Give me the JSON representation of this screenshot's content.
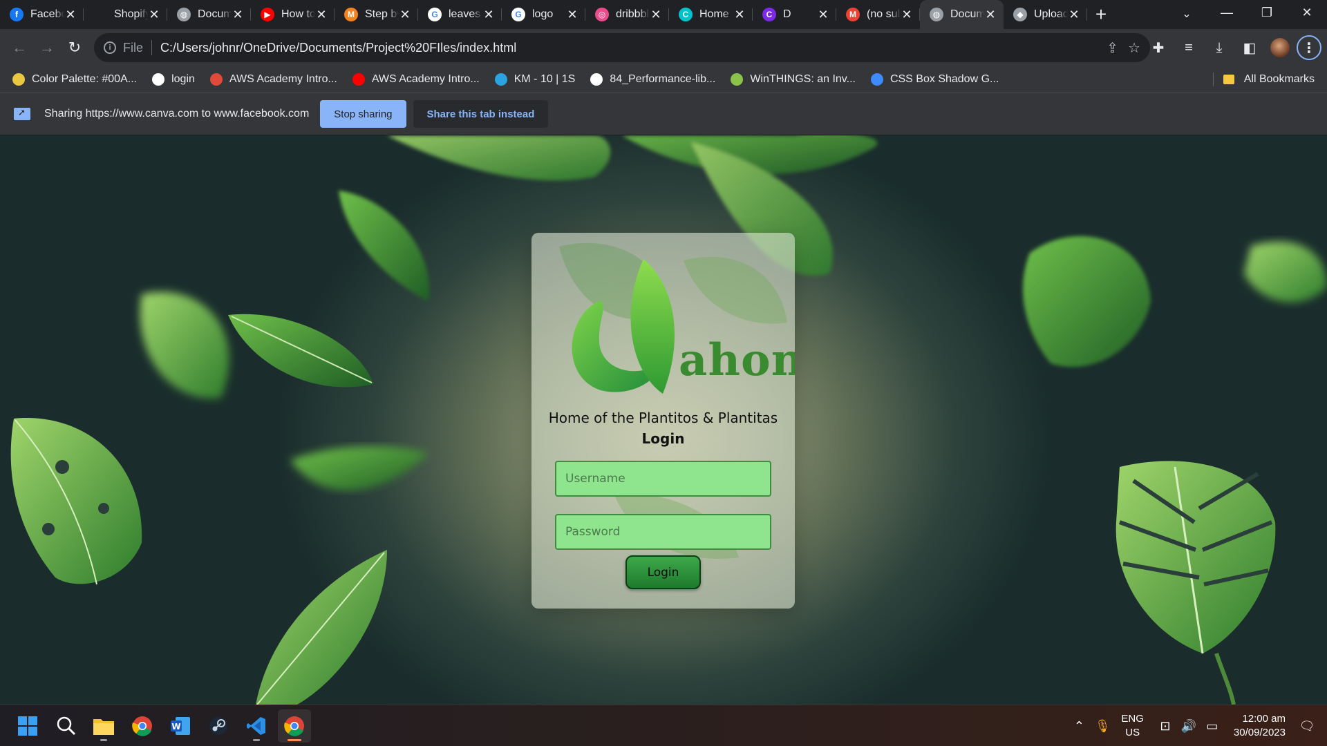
{
  "browser": {
    "tabs": [
      {
        "title": "Facebook",
        "icon": "facebook-icon",
        "color": "#1877f2",
        "glyph": "f"
      },
      {
        "title": "Shopify",
        "icon": "shopify-icon",
        "color": "#202124",
        "glyph": ""
      },
      {
        "title": "Document",
        "icon": "globe-icon",
        "color": "#9aa0a6",
        "glyph": "◍"
      },
      {
        "title": "How to",
        "icon": "youtube-icon",
        "color": "#ff0000",
        "glyph": "▶"
      },
      {
        "title": "Step by step",
        "icon": "medium-icon",
        "color": "#f58220",
        "glyph": "M"
      },
      {
        "title": "leaves",
        "icon": "google-icon",
        "color": "#ffffff",
        "glyph": "G"
      },
      {
        "title": "logo",
        "icon": "google-icon",
        "color": "#ffffff",
        "glyph": "G"
      },
      {
        "title": "dribbble",
        "icon": "dribbble-icon",
        "color": "#ea4c89",
        "glyph": "◎"
      },
      {
        "title": "Home",
        "icon": "canva-icon",
        "color": "#00c4cc",
        "glyph": "C"
      },
      {
        "title": "D",
        "icon": "canva-icon",
        "color": "#7d2ae8",
        "glyph": "C"
      },
      {
        "title": "(no subject)",
        "icon": "gmail-icon",
        "color": "#ea4335",
        "glyph": "M"
      },
      {
        "title": "Document",
        "icon": "globe-icon",
        "color": "#9aa0a6",
        "glyph": "◍",
        "active": true
      },
      {
        "title": "Upload",
        "icon": "upload-icon",
        "color": "#9aa0a6",
        "glyph": "◆"
      }
    ],
    "url_scheme": "File",
    "url": "C:/Users/johnr/OneDrive/Documents/Project%20FIles/index.html",
    "bookmarks": [
      {
        "label": "Color Palette: #00A...",
        "icon": "palette-icon",
        "color": "#e8c840"
      },
      {
        "label": "login",
        "icon": "github-icon",
        "color": "#ffffff"
      },
      {
        "label": "AWS Academy Intro...",
        "icon": "aws-icon",
        "color": "#e04a3a"
      },
      {
        "label": "AWS Academy Intro...",
        "icon": "youtube-icon",
        "color": "#ff0000"
      },
      {
        "label": "KM - 10 | 1S",
        "icon": "telegram-icon",
        "color": "#2aa3e0"
      },
      {
        "label": "84_Performance-lib...",
        "icon": "globe-icon",
        "color": "#ffffff"
      },
      {
        "label": "WinTHINGS: an Inv...",
        "icon": "puzzle-icon",
        "color": "#8bc34a"
      },
      {
        "label": "CSS Box Shadow G...",
        "icon": "layers-icon",
        "color": "#3d8bfd"
      }
    ],
    "all_bookmarks": "All Bookmarks",
    "sharing": {
      "text": "Sharing https://www.canva.com to www.facebook.com",
      "stop": "Stop sharing",
      "share_tab": "Share this tab instead"
    }
  },
  "page": {
    "logo_text": "ahon",
    "tagline": "Home of the Plantitos & Plantitas",
    "heading": "Login",
    "username_placeholder": "Username",
    "password_placeholder": "Password",
    "login_button": "Login",
    "accent_color": "#8ee58e"
  },
  "taskbar": {
    "apps": [
      "start-icon",
      "search-icon",
      "file-explorer-icon",
      "chrome-icon",
      "word-icon",
      "steam-icon",
      "vscode-icon",
      "chrome-icon"
    ],
    "lang": "ENG",
    "region": "US",
    "time": "12:00 am",
    "date": "30/09/2023"
  }
}
